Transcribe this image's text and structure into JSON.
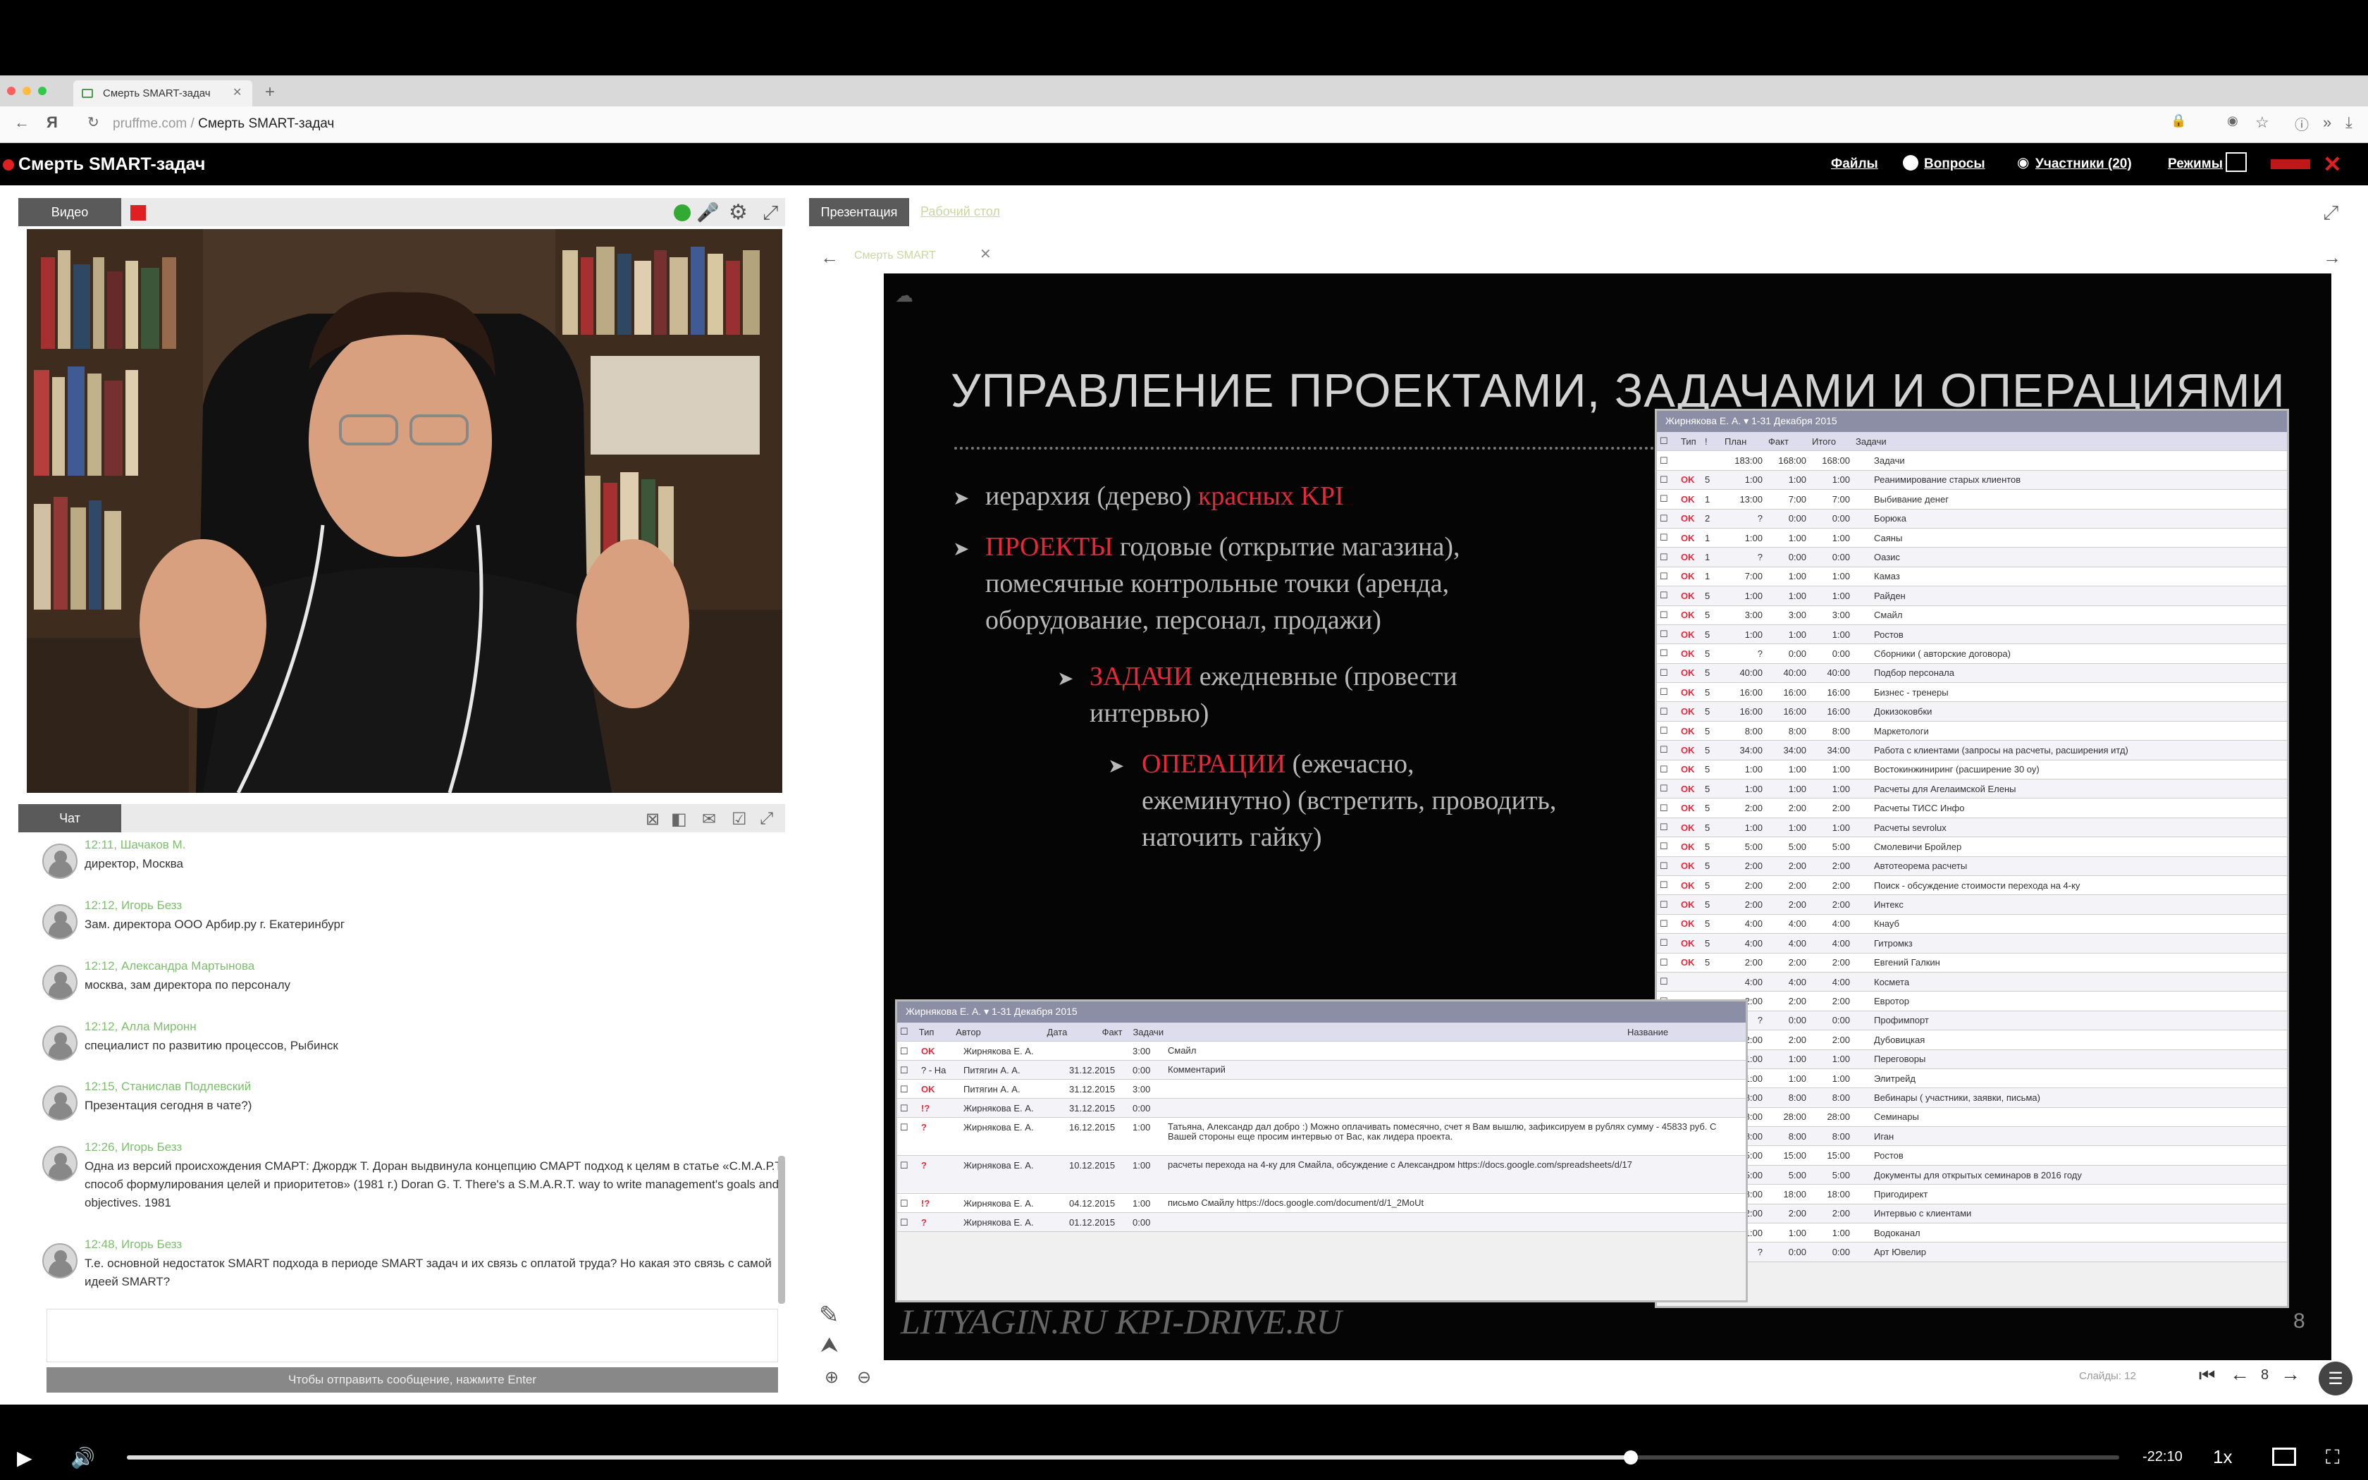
{
  "browser": {
    "tab_title": "Смерть SMART-задач",
    "url_domain": "pruffme.com",
    "url_separator": " / ",
    "url_path": "Смерть SMART-задач"
  },
  "app": {
    "title": "Смерть SMART-задач",
    "nav": [
      "Файлы",
      "Вопросы",
      "Участники (20)",
      "Режимы"
    ]
  },
  "video": {
    "tab_label": "Видео"
  },
  "presentation": {
    "tab_label": "Презентация",
    "tab2_label": "Рабочий стол",
    "doc_tab": "Смерть SMART",
    "slide_counter_label": "Слайды: 12",
    "page": "8"
  },
  "chat": {
    "tab_label": "Чат",
    "input_hint": "Чтобы отправить сообщение, нажмите Enter",
    "messages": [
      {
        "time": "12:11",
        "author": "Шачаков М.",
        "text": "директор, Москва"
      },
      {
        "time": "12:12",
        "author": "Игорь Безз",
        "text": "Зам. директора ООО Арбир.ру г. Екатеринбург"
      },
      {
        "time": "12:12",
        "author": "Александра Мартынова",
        "text": "москва, зам директора по персоналу"
      },
      {
        "time": "12:12",
        "author": "Алла Миронн",
        "text": "специалист по развитию процессов, Рыбинск"
      },
      {
        "time": "12:15",
        "author": "Станислав Подлевский",
        "text": "Презентация сегодня в чате?)"
      },
      {
        "time": "12:26",
        "author": "Игорь Безз",
        "text": "Одна из версий происхождения СМАРТ: Джордж Т. Доран выдвинула концепцию СМАРТ подход к целям в статье «С.М.А.Р.Т. способ формулирования целей и приоритетов» (1981 г.) Doran G. T. There's a S.M.A.R.T. way to write management's goals and objectives. 1981"
      },
      {
        "time": "12:48",
        "author": "Игорь Безз",
        "text": "Т.е. основной недостаток SMART подхода в периоде SMART задач и их связь с оплатой труда? Но какая это связь с самой идеей SMART?"
      }
    ]
  },
  "slide": {
    "title": "УПРАВЛЕНИЕ ПРОЕКТАМИ, ЗАДАЧАМИ И ОПЕРАЦИЯМИ",
    "b1_pre": "иерархия (дерево) ",
    "b1_red": "красных KPI",
    "b2_red": "ПРОЕКТЫ",
    "b2_rest": " годовые (открытие магазина), помесячные контрольные точки (аренда, оборудование, персонал, продажи)",
    "b3_red": "ЗАДАЧИ",
    "b3_rest": " ежедневные (провести интервью)",
    "b4_red": "ОПЕРАЦИИ",
    "b4_rest": " (ежечасно, ежеминутно) (встретить, проводить, наточить гайку)",
    "footer": "LITYAGIN.RU  KPI-DRIVE.RU"
  },
  "sheet_right": {
    "header": "Жирнякова Е. А.  ▾  1-31 Декабря 2015",
    "cols": [
      "Тип",
      "!",
      "План",
      "Факт",
      "Итого",
      "Задачи"
    ],
    "rows": [
      [
        "",
        "",
        "183:00",
        "168:00",
        "168:00",
        "Задачи"
      ],
      [
        "OK",
        "5",
        "1:00",
        "1:00",
        "1:00",
        "Реанимирование старых клиентов"
      ],
      [
        "OK",
        "1",
        "13:00",
        "7:00",
        "7:00",
        "Выбивание денег"
      ],
      [
        "OK",
        "2",
        "?",
        "0:00",
        "0:00",
        "Борюка"
      ],
      [
        "OK",
        "1",
        "1:00",
        "1:00",
        "1:00",
        "Саяны"
      ],
      [
        "OK",
        "1",
        "?",
        "0:00",
        "0:00",
        "Оазис"
      ],
      [
        "OK",
        "1",
        "7:00",
        "1:00",
        "1:00",
        "Камаз"
      ],
      [
        "OK",
        "5",
        "1:00",
        "1:00",
        "1:00",
        "Райден"
      ],
      [
        "OK",
        "5",
        "3:00",
        "3:00",
        "3:00",
        "Смайл"
      ],
      [
        "OK",
        "5",
        "1:00",
        "1:00",
        "1:00",
        "Ростов"
      ],
      [
        "OK",
        "5",
        "?",
        "0:00",
        "0:00",
        "Сборники ( авторские договора)"
      ],
      [
        "OK",
        "5",
        "40:00",
        "40:00",
        "40:00",
        "Подбор персонала"
      ],
      [
        "OK",
        "5",
        "16:00",
        "16:00",
        "16:00",
        "Бизнес - тренеры"
      ],
      [
        "OK",
        "5",
        "16:00",
        "16:00",
        "16:00",
        "Докизоковбки"
      ],
      [
        "OK",
        "5",
        "8:00",
        "8:00",
        "8:00",
        "Маркетологи"
      ],
      [
        "OK",
        "5",
        "34:00",
        "34:00",
        "34:00",
        "Работа с клиентами (запросы на расчеты, расширения итд)"
      ],
      [
        "OK",
        "5",
        "1:00",
        "1:00",
        "1:00",
        "Востокинжиниринг (расширение 30 оу)"
      ],
      [
        "OK",
        "5",
        "1:00",
        "1:00",
        "1:00",
        "Расчеты для Агелаимской Елены"
      ],
      [
        "OK",
        "5",
        "2:00",
        "2:00",
        "2:00",
        "Расчеты ТИСС Инфо"
      ],
      [
        "OK",
        "5",
        "1:00",
        "1:00",
        "1:00",
        "Расчеты sevrolux"
      ],
      [
        "OK",
        "5",
        "5:00",
        "5:00",
        "5:00",
        "Смолевичи Бройлер"
      ],
      [
        "OK",
        "5",
        "2:00",
        "2:00",
        "2:00",
        "Автотеорема расчеты"
      ],
      [
        "OK",
        "5",
        "2:00",
        "2:00",
        "2:00",
        "Поиск - обсуждение стоимости перехода на 4-ку"
      ],
      [
        "OK",
        "5",
        "2:00",
        "2:00",
        "2:00",
        "Интекс"
      ],
      [
        "OK",
        "5",
        "4:00",
        "4:00",
        "4:00",
        "Кнауб"
      ],
      [
        "OK",
        "5",
        "4:00",
        "4:00",
        "4:00",
        "Гитромкз"
      ],
      [
        "OK",
        "5",
        "2:00",
        "2:00",
        "2:00",
        "Евгений Галкин"
      ],
      [
        "",
        "",
        "4:00",
        "4:00",
        "4:00",
        "Космета"
      ],
      [
        "",
        "",
        "2:00",
        "2:00",
        "2:00",
        "Евротор"
      ],
      [
        "",
        "",
        "?",
        "0:00",
        "0:00",
        "Профимпорт"
      ],
      [
        "",
        "",
        "2:00",
        "2:00",
        "2:00",
        "Дубовицкая"
      ],
      [
        "",
        "",
        "1:00",
        "1:00",
        "1:00",
        "Переговоры"
      ],
      [
        "",
        "",
        "1:00",
        "1:00",
        "1:00",
        "Элитрейд"
      ],
      [
        "",
        "",
        "8:00",
        "8:00",
        "8:00",
        "Вебинары ( участники, заявки, письма)"
      ],
      [
        "",
        "",
        "28:00",
        "28:00",
        "28:00",
        "Семинары"
      ],
      [
        "",
        "",
        "8:00",
        "8:00",
        "8:00",
        "Иган"
      ],
      [
        "",
        "",
        "15:00",
        "15:00",
        "15:00",
        "Ростов"
      ],
      [
        "",
        "",
        "5:00",
        "5:00",
        "5:00",
        "Документы для открытых семинаров в 2016 году"
      ],
      [
        "",
        "",
        "18:00",
        "18:00",
        "18:00",
        "Пригодирект"
      ],
      [
        "",
        "",
        "2:00",
        "2:00",
        "2:00",
        "Интервью с клиентами"
      ],
      [
        "",
        "",
        "1:00",
        "1:00",
        "1:00",
        "Водоканал"
      ],
      [
        "",
        "",
        "?",
        "0:00",
        "0:00",
        "Арт Ювелир"
      ]
    ]
  },
  "sheet_left": {
    "header": "Жирнякова Е. А.  ▾  1-31 Декабря 2015",
    "cols": [
      "Тип",
      "Автор",
      "Дата",
      "Факт",
      "Задачи",
      "Название"
    ],
    "rows": [
      [
        "OK",
        "Жирнякова Е. А.",
        "",
        "3:00",
        "Смайл"
      ],
      [
        "? - На",
        "Питягин А. А.",
        "31.12.2015",
        "0:00",
        "Комментарий"
      ],
      [
        "OK",
        "Питягин А. А.",
        "31.12.2015",
        "3:00",
        ""
      ],
      [
        "!?",
        "Жирнякова Е. А.",
        "31.12.2015",
        "0:00",
        ""
      ],
      [
        "?",
        "Жирнякова Е. А.",
        "16.12.2015",
        "1:00",
        "Татьяна, Александр дал добро :) Можно оплачивать помесячно, счет я Вам вышлю, зафиксируем в рублях сумму - 45833 руб. С Вашей стороны еще просим интервью от Вас, как лидера проекта."
      ],
      [
        "?",
        "Жирнякова Е. А.",
        "10.12.2015",
        "1:00",
        "расчеты перехода на 4-ку для Смайла, обсуждение с Александром https://docs.google.com/spreadsheets/d/17"
      ],
      [
        "!?",
        "Жирнякова Е. А.",
        "04.12.2015",
        "1:00",
        "письмо Смайлу https://docs.google.com/document/d/1_2MoUt"
      ],
      [
        "?",
        "Жирнякова Е. А.",
        "01.12.2015",
        "0:00",
        ""
      ]
    ]
  },
  "player": {
    "time_remaining": "-22:10",
    "speed": "1x",
    "progress_fraction": 0.755
  }
}
